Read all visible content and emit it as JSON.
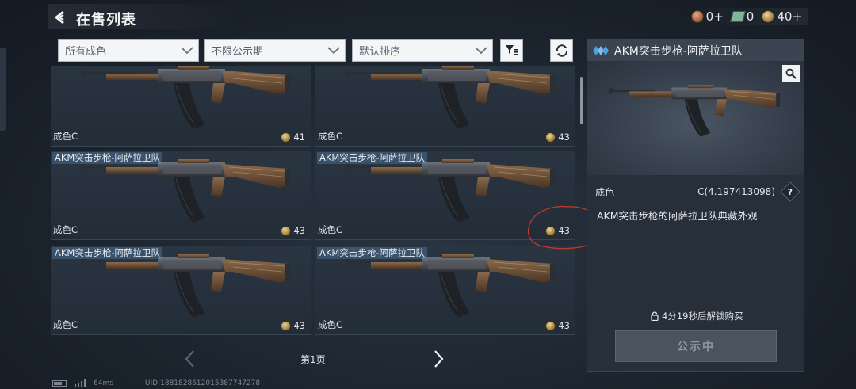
{
  "header": {
    "title": "在售列表",
    "currencies": [
      {
        "icon": "copper-coin-icon",
        "value": "0+"
      },
      {
        "icon": "ticket-icon",
        "value": "0"
      },
      {
        "icon": "gold-coin-icon",
        "value": "40+"
      }
    ]
  },
  "filters": {
    "condition": "所有成色",
    "period": "不限公示期",
    "sort": "默认排序"
  },
  "listings": [
    {
      "name": "",
      "condition": "成色C",
      "price": "41"
    },
    {
      "name": "",
      "condition": "成色C",
      "price": "43"
    },
    {
      "name": "AKM突击步枪-阿萨拉卫队",
      "condition": "成色C",
      "price": "43"
    },
    {
      "name": "AKM突击步枪-阿萨拉卫队",
      "condition": "成色C",
      "price": "43"
    },
    {
      "name": "AKM突击步枪-阿萨拉卫队",
      "condition": "成色C",
      "price": "43"
    },
    {
      "name": "AKM突击步枪-阿萨拉卫队",
      "condition": "成色C",
      "price": "43"
    }
  ],
  "pagination": {
    "label": "第1页"
  },
  "detail": {
    "title": "AKM突击步枪-阿萨拉卫队",
    "condition_label": "成色",
    "condition_value": "C(4.197413098)",
    "help": "?",
    "description": "AKM突击步枪的阿萨拉卫队典藏外观",
    "lock_note": "4分19秒后解锁购买",
    "button": "公示中"
  },
  "footer": {
    "ping": "64ms",
    "uid": "UID:1881828612015387747278"
  },
  "colors": {
    "annotation": "#c0392b",
    "accent": "#4da3e0"
  }
}
